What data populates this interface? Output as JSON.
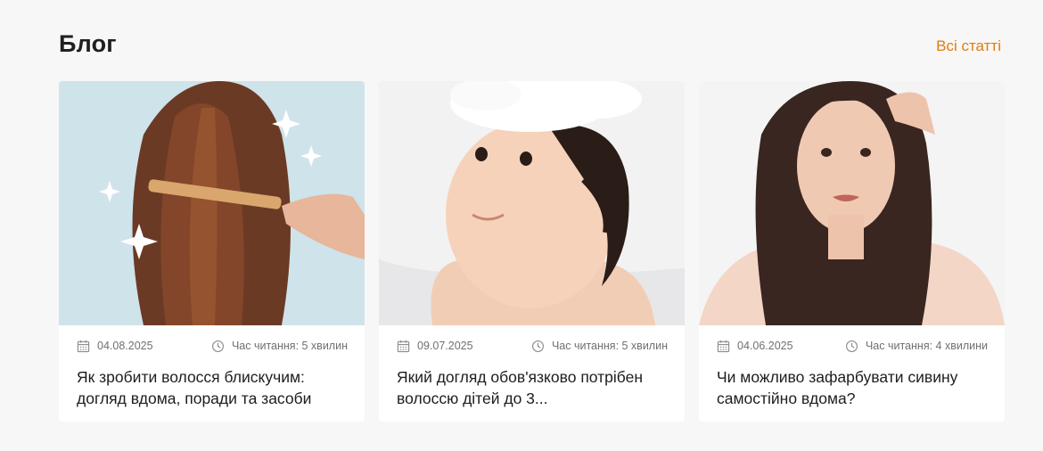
{
  "blog": {
    "title": "Блог",
    "all_link": "Всі статті"
  },
  "icons": {
    "date": "calendar-icon",
    "time": "clock-icon"
  },
  "colors": {
    "accent": "#e07d10",
    "background": "#f7f7f7",
    "card": "#ffffff"
  },
  "cards": [
    {
      "date": "04.08.2025",
      "read_time": "Час читання: 5 хвилин",
      "title": "Як зробити волосся блискучим: догляд вдома, поради та засоби"
    },
    {
      "date": "09.07.2025",
      "read_time": "Час читання: 5 хвилин",
      "title": "Який догляд обов'язково потрібен волоссю дітей до 3..."
    },
    {
      "date": "04.06.2025",
      "read_time": "Час читання: 4 хвилини",
      "title": "Чи можливо зафарбувати сивину самостійно вдома?"
    }
  ]
}
